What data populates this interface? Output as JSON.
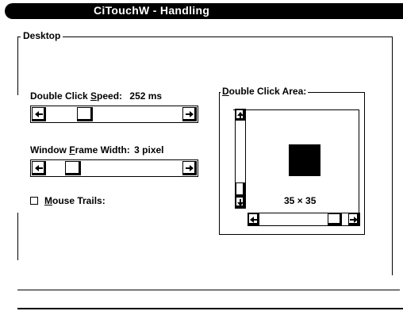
{
  "window": {
    "title": "CiTouchW - Handling"
  },
  "desktop_group": {
    "label": "Desktop"
  },
  "double_click_speed": {
    "label_pre": "Double Click ",
    "label_accel": "S",
    "label_post": "peed:",
    "value": "252 ms",
    "level": 0.25
  },
  "window_frame_width": {
    "label_pre": "Window ",
    "label_accel": "F",
    "label_post": "rame Width:",
    "value": "3 pixel",
    "level": 0.15
  },
  "mouse_trails": {
    "label_accel": "M",
    "label_post": "ouse Trails:",
    "checked": false
  },
  "double_click_area": {
    "label_accel": "D",
    "label_post": "ouble Click Area:",
    "size_text": "35 × 35",
    "vertical_level": 1.0,
    "horizontal_level": 0.92
  },
  "icons": {
    "left": "left-arrow-icon",
    "right": "right-arrow-icon",
    "up": "up-arrow-icon",
    "down": "down-arrow-icon"
  }
}
